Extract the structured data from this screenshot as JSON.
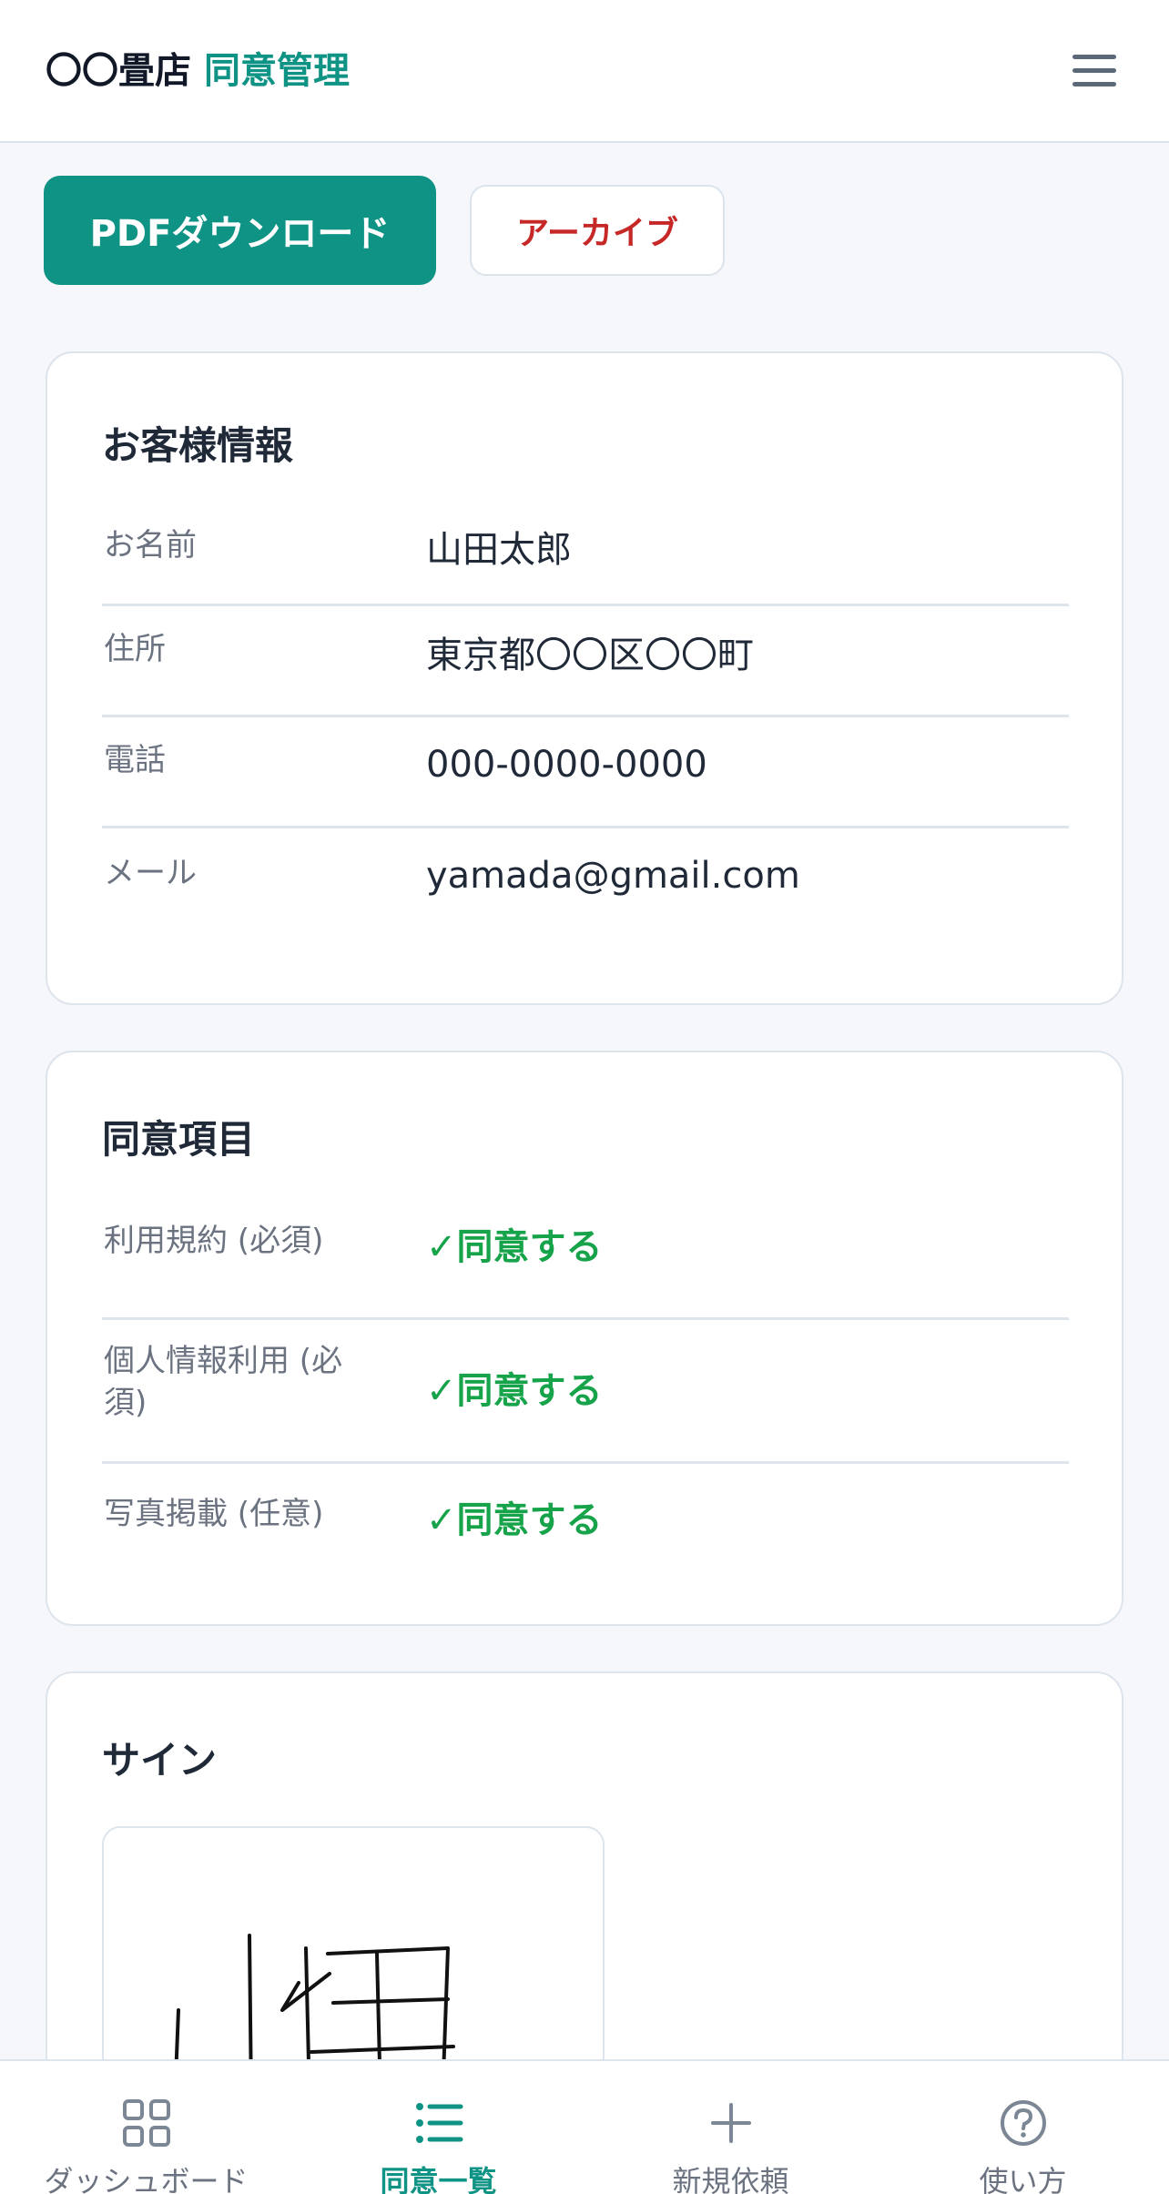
{
  "header": {
    "shop_name": "〇〇畳店",
    "app_name": "同意管理",
    "menu_icon": "hamburger-menu-icon"
  },
  "actions": {
    "pdf_label": "PDFダウンロード",
    "archive_label": "アーカイブ"
  },
  "customer": {
    "title": "お客様情報",
    "rows": [
      {
        "label": "お名前",
        "value": "山田太郎"
      },
      {
        "label": "住所",
        "value": "東京都〇〇区〇〇町"
      },
      {
        "label": "電話",
        "value": "000-0000-0000"
      },
      {
        "label": "メール",
        "value": "yamada@gmail.com"
      }
    ]
  },
  "consent": {
    "title": "同意項目",
    "rows": [
      {
        "label": "利用規約 (必須)",
        "value": "✓同意する"
      },
      {
        "label": "個人情報利用 (必須)",
        "value": "✓同意する"
      },
      {
        "label": "写真掲載 (任意)",
        "value": "✓同意する"
      }
    ]
  },
  "signature": {
    "title": "サイン"
  },
  "bottom_nav": {
    "items": [
      {
        "label": "ダッシュボード",
        "icon": "dashboard-grid-icon"
      },
      {
        "label": "同意一覧",
        "icon": "list-icon",
        "active": true
      },
      {
        "label": "新規依頼",
        "icon": "plus-icon"
      },
      {
        "label": "使い方",
        "icon": "help-circle-icon"
      }
    ]
  },
  "colors": {
    "accent": "#0f9384",
    "danger": "#c62828",
    "success": "#16a34a",
    "background": "#f5f7fa"
  }
}
